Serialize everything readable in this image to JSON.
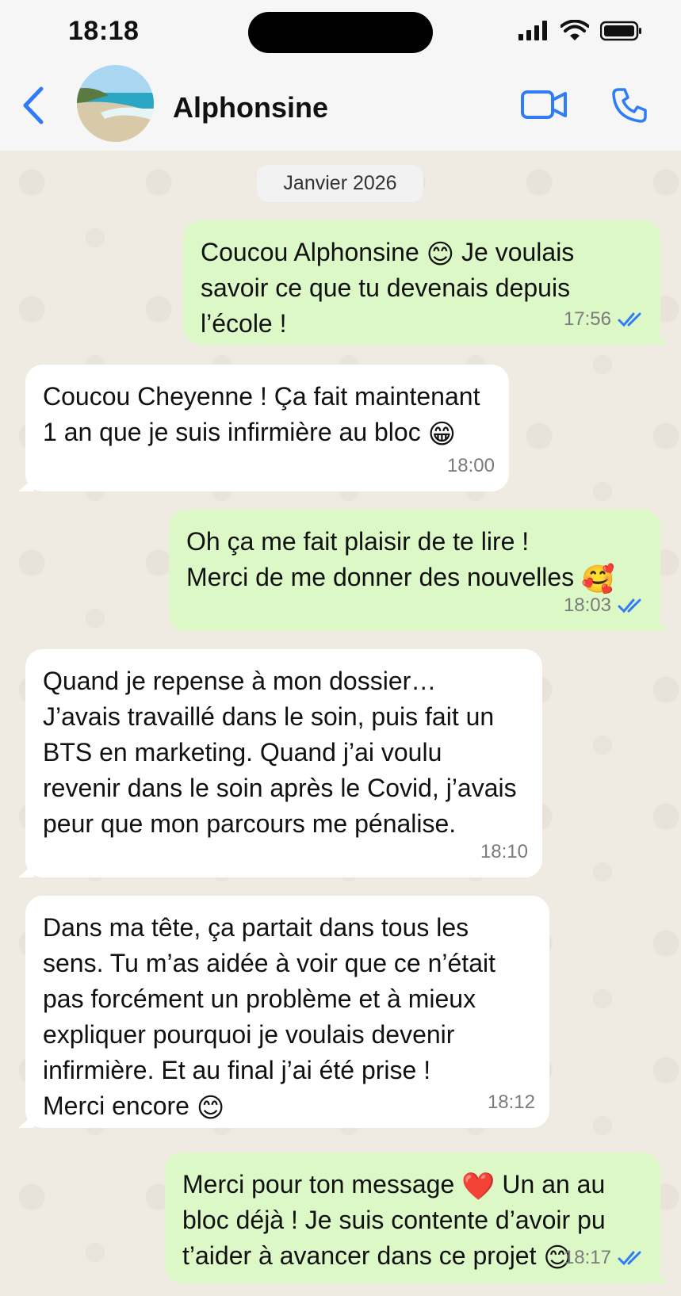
{
  "status_bar": {
    "time": "18:18"
  },
  "header": {
    "contact_name": "Alphonsine",
    "icons": {
      "back": "back-chevron-icon",
      "video": "video-call-icon",
      "phone": "phone-call-icon",
      "signal": "cellular-signal-icon",
      "wifi": "wifi-icon",
      "battery": "battery-icon"
    }
  },
  "chat": {
    "date_badge": "Janvier 2026",
    "messages": [
      {
        "direction": "out",
        "text": "Coucou Alphonsine",
        "emoji": "😊",
        "text2": " Je voulais savoir ce que tu devenais depuis l’école !",
        "time": "17:56",
        "read": true
      },
      {
        "direction": "in",
        "text": "Coucou Cheyenne ! Ça fait maintenant 1 an que je suis infirmière au bloc",
        "emoji": "😁",
        "time": "18:00"
      },
      {
        "direction": "out",
        "text": "Oh ça me fait plaisir de te lire !\nMerci de me donner des nouvelles",
        "emoji": "🥰",
        "time": "18:03",
        "read": true
      },
      {
        "direction": "in",
        "text": "Quand je repense à mon dossier…\nJ’avais travaillé dans le soin, puis fait un BTS en marketing. Quand j’ai voulu revenir dans le soin après le Covid, j’avais peur que mon parcours me pénalise.",
        "time": "18:10"
      },
      {
        "direction": "in",
        "text": "Dans ma tête, ça partait dans tous les sens. Tu m’as aidée à voir que ce n’était pas forcément un problème et à mieux expliquer pourquoi je voulais devenir infirmière. Et au final j’ai été prise !\nMerci encore",
        "emoji": "😊",
        "time": "18:12"
      },
      {
        "direction": "out",
        "text": "Merci pour ton message",
        "emoji": "❤️",
        "text2": " Un an au bloc déjà ! Je suis contente d’avoir pu t’aider à avancer dans ce projet",
        "emoji2": "😊",
        "time": "18:17",
        "read": true
      }
    ]
  },
  "colors": {
    "accent": "#2f7cf6",
    "outgoing_bubble": "#dcf8c6",
    "incoming_bubble": "#ffffff",
    "chat_background": "#efeae2"
  }
}
